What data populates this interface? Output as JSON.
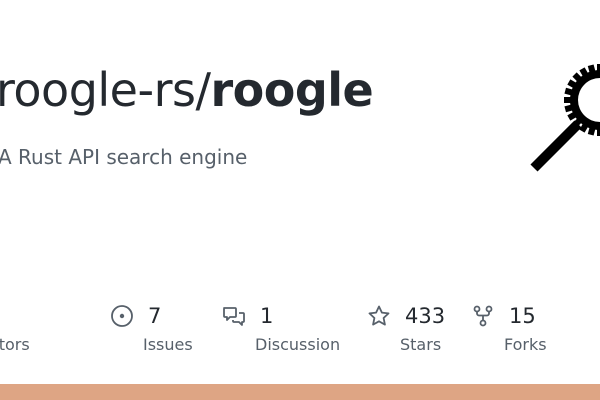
{
  "repo": {
    "owner": "roogle-rs",
    "slash": "/",
    "name": "roogle",
    "description": "A Rust API search engine"
  },
  "stats": [
    {
      "value": "",
      "label": "Contributors",
      "icon": "people-icon"
    },
    {
      "value": "7",
      "label": "Issues",
      "icon": "issue-opened-icon"
    },
    {
      "value": "1",
      "label": "Discussion",
      "icon": "comment-discussion-icon"
    },
    {
      "value": "433",
      "label": "Stars",
      "icon": "star-icon"
    },
    {
      "value": "15",
      "label": "Forks",
      "icon": "repo-forked-icon"
    }
  ],
  "colors": {
    "text_primary": "#24292f",
    "text_secondary": "#57606a",
    "language_bar": "#dea584"
  }
}
